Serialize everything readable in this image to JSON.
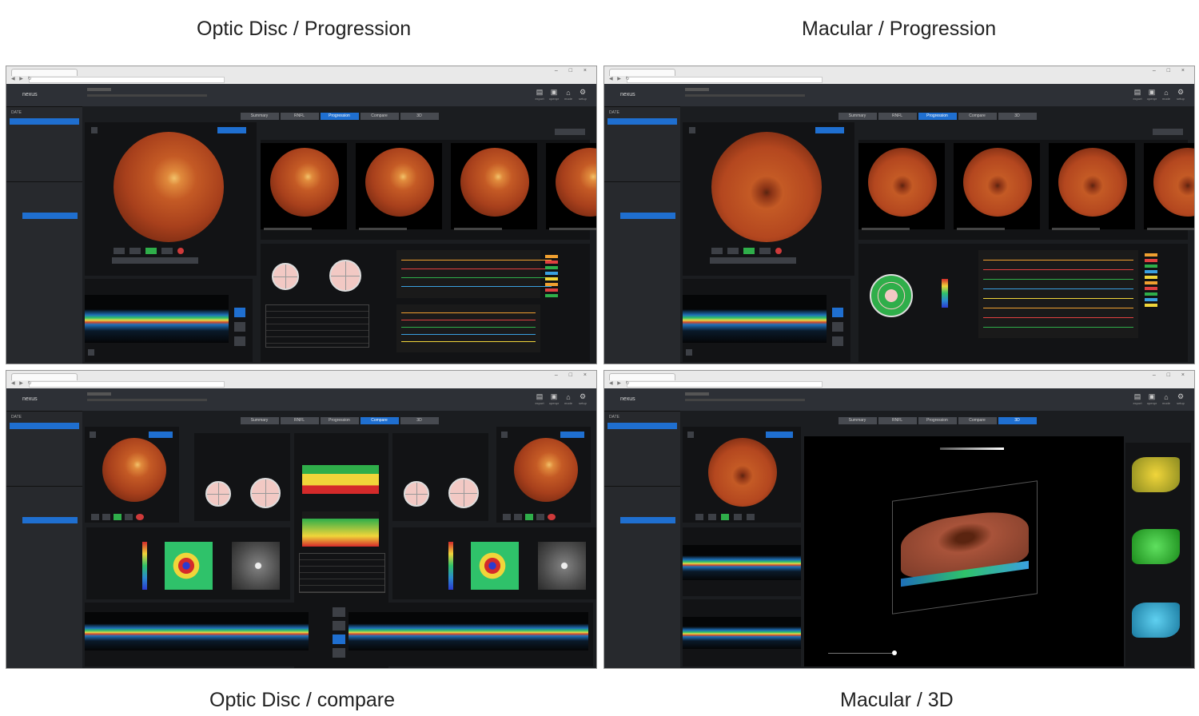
{
  "captions": {
    "top_left": "Optic Disc / Progression",
    "top_right": "Macular / Progression",
    "bottom_left": "Optic Disc / compare",
    "bottom_right": "Macular / 3D"
  },
  "colors": {
    "accent": "#1f6fd0",
    "panel_bg": "#121315",
    "app_bg": "#1b1d20",
    "fundus": "#c45a25",
    "series": [
      "#f0a030",
      "#e04040",
      "#2fae4a",
      "#3aa0e0",
      "#f0d53a"
    ]
  },
  "app": {
    "brand": "nexus",
    "date_label": "DATE",
    "tabs": [
      "Summary",
      "RNFL",
      "Progression",
      "Compare",
      "3D"
    ],
    "tools": [
      {
        "icon": "export-icon",
        "label": "export"
      },
      {
        "icon": "folder-icon",
        "label": "openpr"
      },
      {
        "icon": "home-icon",
        "label": "mode"
      },
      {
        "icon": "gear-icon",
        "label": "setup"
      }
    ],
    "window_controls": "– □ ×"
  }
}
